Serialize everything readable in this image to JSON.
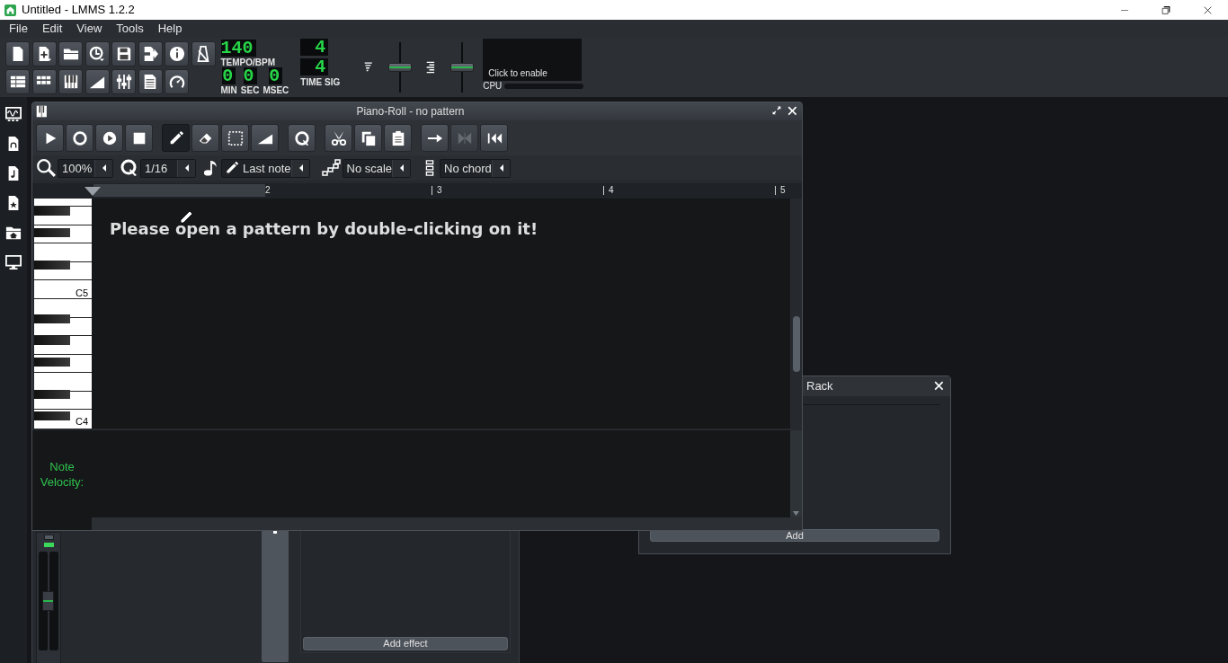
{
  "window": {
    "title": "Untitled - LMMS 1.2.2"
  },
  "menu": [
    "File",
    "Edit",
    "View",
    "Tools",
    "Help"
  ],
  "toolbar": {
    "tempo": {
      "value": "140",
      "label": "TEMPO/BPM"
    },
    "time": [
      {
        "value": "0",
        "label": "MIN"
      },
      {
        "value": "0",
        "label": "SEC"
      },
      {
        "value": "0",
        "label": "MSEC"
      }
    ],
    "time_sig": {
      "numerator": "4",
      "denominator": "4",
      "label": "TIME SIG"
    },
    "master_volume": {
      "level": 0.5
    },
    "master_pitch": {
      "level": 0.5
    },
    "cpu": {
      "hint": "Click to enable",
      "label": "CPU"
    }
  },
  "piano_roll": {
    "title": "Piano-Roll - no pattern",
    "edit_tools": [
      {
        "selected": true
      },
      {
        "selected": false
      },
      {
        "selected": false
      },
      {
        "selected": false
      }
    ],
    "timeline_buttons": [
      {
        "disabled": false
      },
      {
        "disabled": true
      },
      {
        "disabled": false
      }
    ],
    "zoom": "100%",
    "quantize": "1/16",
    "note_length": "Last note",
    "scale": "No scale",
    "chord": "No chord",
    "bars": [
      "2",
      "3",
      "4",
      "5"
    ],
    "key_labels": [
      "C5",
      "C4"
    ],
    "message": "Please open a pattern by double-clicking on it!",
    "velocity_label": "Note Velocity:"
  },
  "instrument_window": {
    "mute": {
      "on": true
    },
    "fader": {
      "level": 0.5
    },
    "add_effect": "Add effect"
  },
  "effects_rack": {
    "title": "Rack",
    "add_button": "Add"
  }
}
